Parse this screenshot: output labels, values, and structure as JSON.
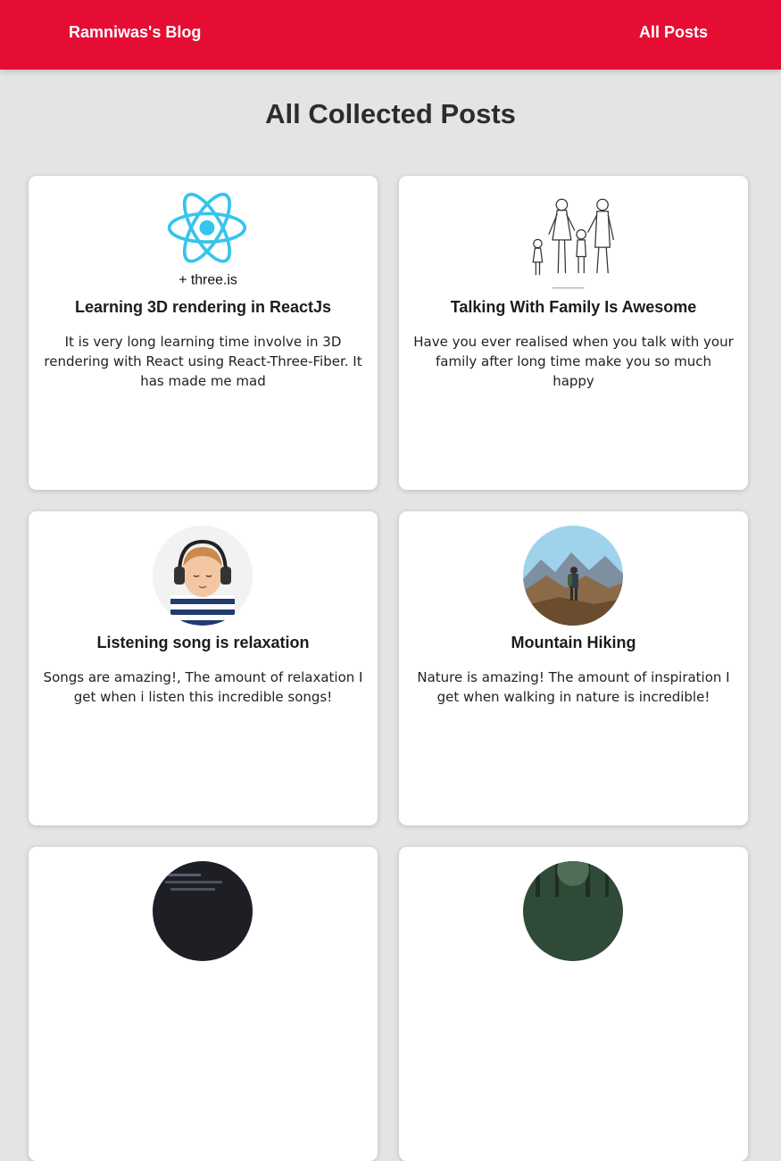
{
  "navbar": {
    "brand": "Ramniwas's Blog",
    "all_posts_link": "All Posts",
    "color": "#e60d34"
  },
  "page": {
    "title": "All Collected Posts"
  },
  "posts": [
    {
      "title": "Learning 3D rendering in ReactJs",
      "description": "It is very long learning time involve in 3D rendering with React using React-Three-Fiber. It has made me mad",
      "image": "react-three-js-logo",
      "image_caption": "+ three.js"
    },
    {
      "title": "Talking With Family Is Awesome",
      "description": "Have you ever realised when you talk with your family after long time make you so much happy",
      "image": "family-sketch"
    },
    {
      "title": "Listening song is relaxation",
      "description": "Songs are amazing!, The amount of relaxation I get when i listen this incredible songs!",
      "image": "child-with-headphones"
    },
    {
      "title": "Mountain Hiking",
      "description": "Nature is amazing! The amount of inspiration I get when walking in nature is incredible!",
      "image": "hiker-mountains"
    },
    {
      "title": "",
      "description": "",
      "image": "dark-code-thumbnail"
    },
    {
      "title": "",
      "description": "",
      "image": "forest-thumbnail"
    }
  ]
}
